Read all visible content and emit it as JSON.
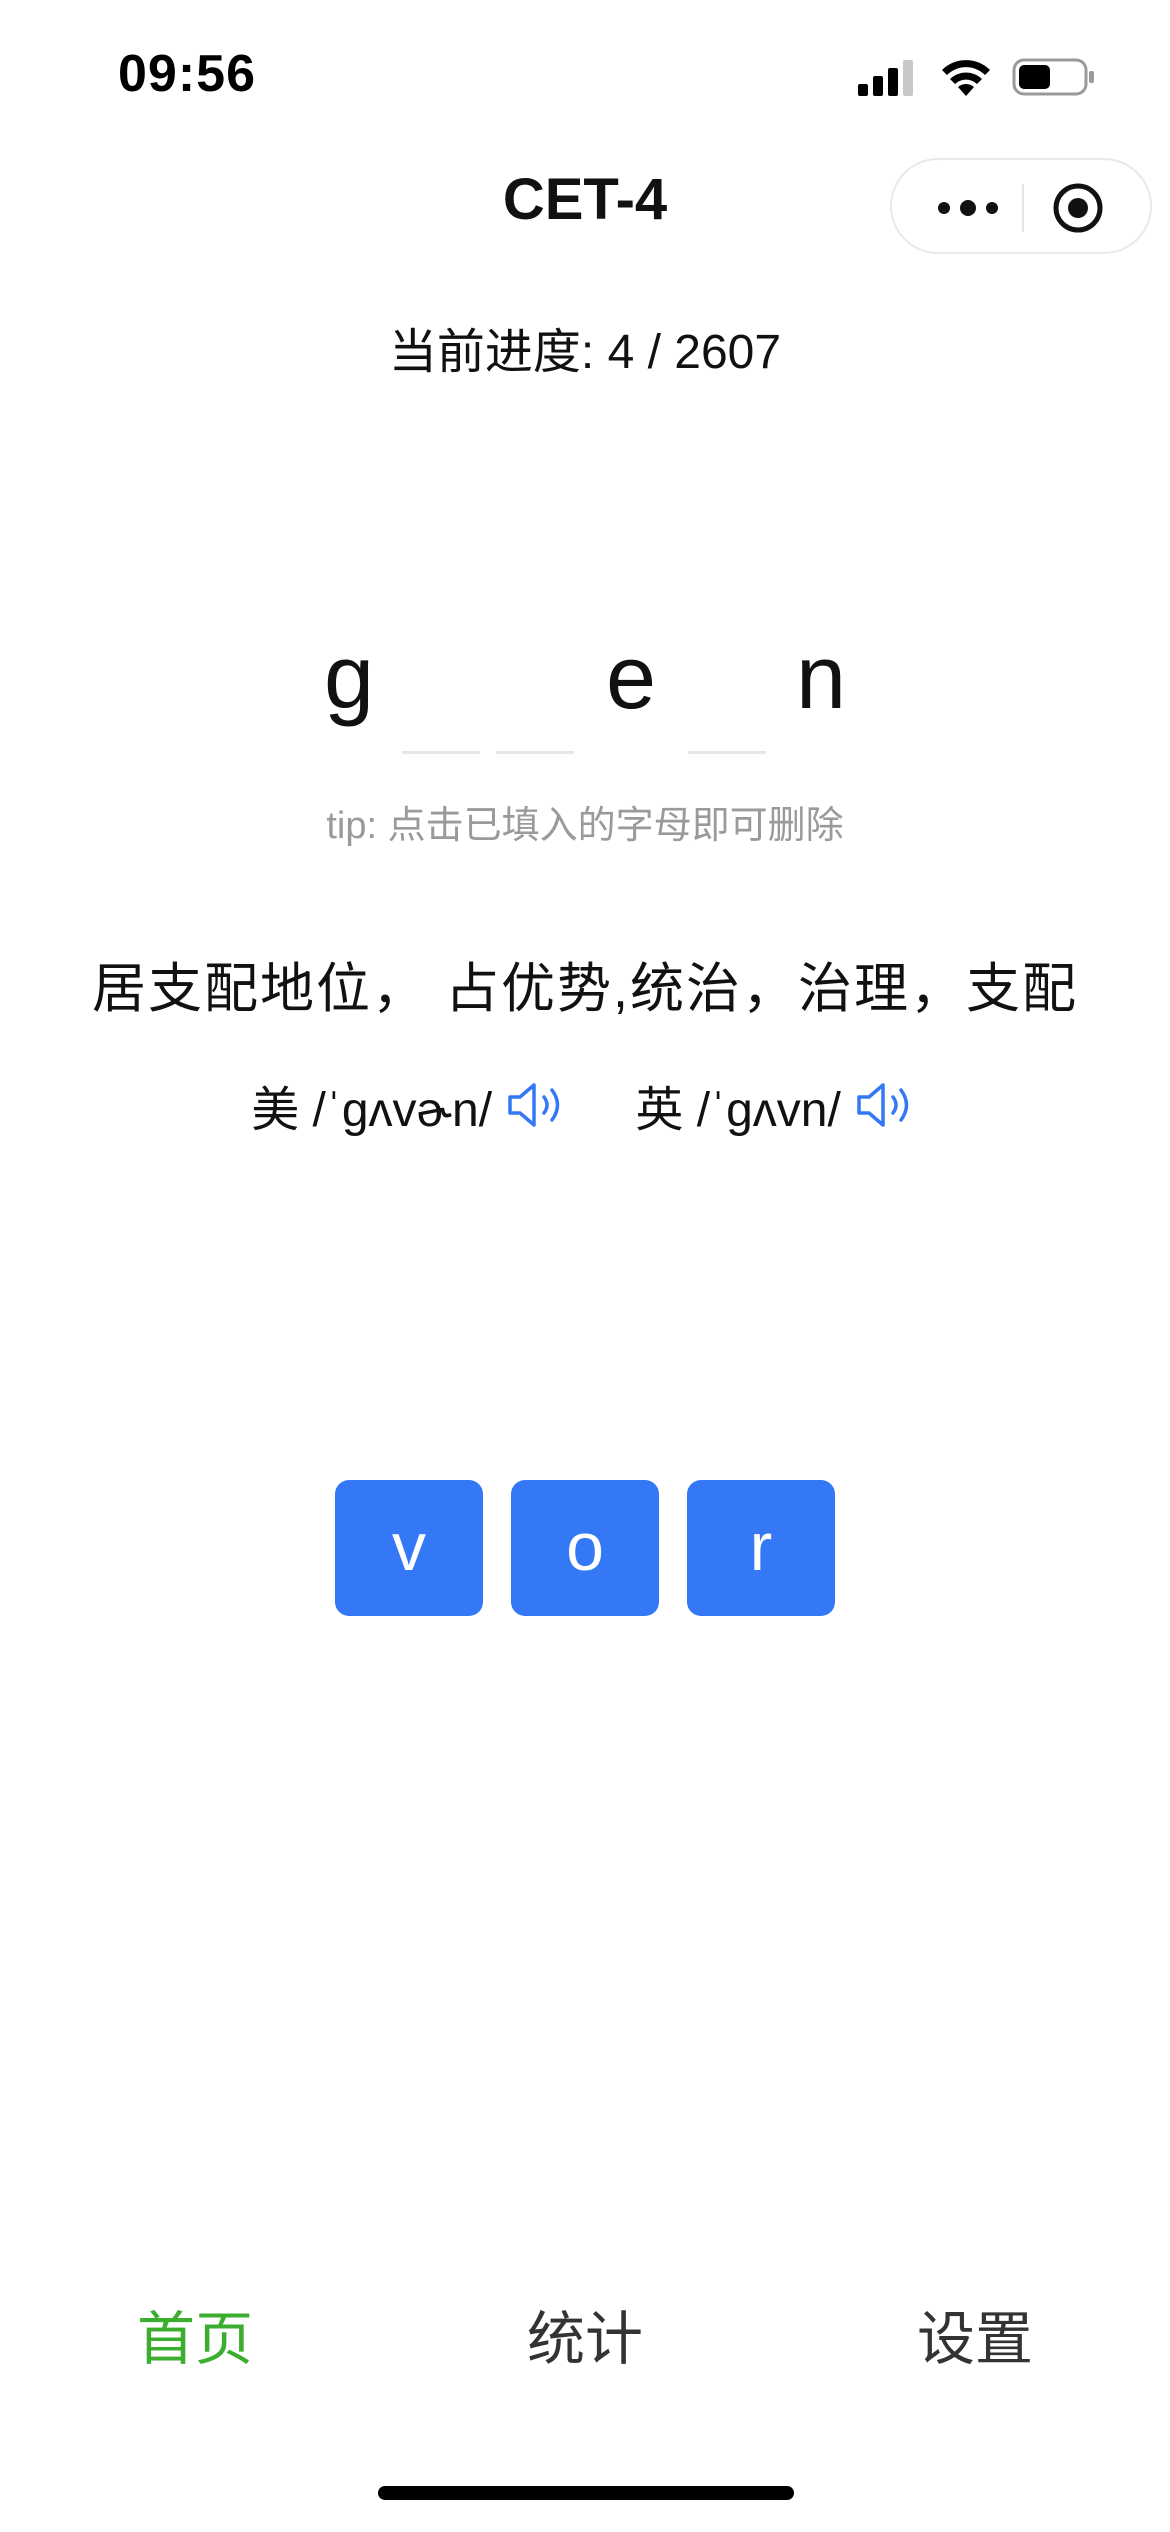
{
  "status_bar": {
    "time": "09:56",
    "battery_level": 0.5
  },
  "nav": {
    "title": "CET-4",
    "capsule_icons": [
      "more-icon",
      "target-icon"
    ]
  },
  "progress_text": "当前进度: 4 / 2607",
  "word": {
    "slots": [
      {
        "letter": "g",
        "filled": true
      },
      {
        "letter": "",
        "filled": false
      },
      {
        "letter": "",
        "filled": false
      },
      {
        "letter": "e",
        "filled": true
      },
      {
        "letter": "",
        "filled": false
      },
      {
        "letter": "n",
        "filled": true
      }
    ]
  },
  "tip": "tip: 点击已填入的字母即可删除",
  "meaning": "居支配地位， 占优势,统治，治理，支配",
  "phonetics": {
    "us": "美 /ˈgʌvɚn/",
    "uk": "英 /ˈgʌvn/"
  },
  "letter_buttons": [
    "v",
    "o",
    "r"
  ],
  "tabs": {
    "home": "首页",
    "stats": "统计",
    "settings": "设置",
    "active": "home"
  },
  "colors": {
    "accent_blue": "#3478f6",
    "tab_active_green": "#3cae2f",
    "tip_gray": "#9a9a9a"
  }
}
